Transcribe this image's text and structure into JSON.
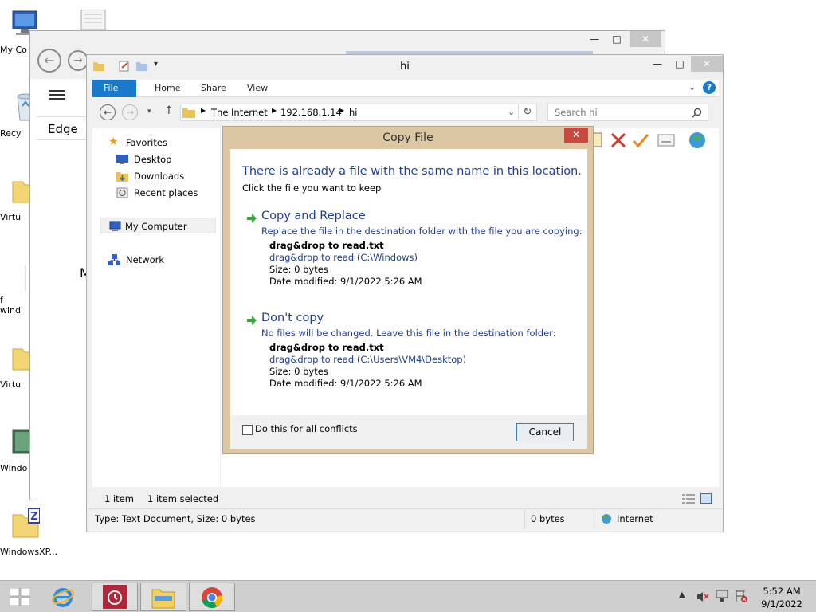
{
  "desktop": {
    "icons": [
      {
        "label": "My Co",
        "icon": "computer-icon"
      },
      {
        "label": "Recy",
        "icon": "recycle-bin-icon"
      },
      {
        "label": "Virtu",
        "icon": "folder-icon"
      },
      {
        "label": "f\nwind",
        "icon": "file-icon"
      },
      {
        "label": "Virtu",
        "icon": "folder-icon"
      },
      {
        "label": "Windo",
        "icon": "image-icon"
      },
      {
        "label": "WindowsXP...",
        "icon": "zip-folder-icon"
      }
    ]
  },
  "edge_window": {
    "sidebar_label": "Edge",
    "partial_text": "M"
  },
  "explorer": {
    "title": "hi",
    "tabs": [
      "File",
      "Home",
      "Share",
      "View"
    ],
    "breadcrumb": [
      "The Internet",
      "192.168.1.14",
      "hi"
    ],
    "search_placeholder": "Search hi",
    "nav": {
      "favorites": "Favorites",
      "desktop": "Desktop",
      "downloads": "Downloads",
      "recent": "Recent places",
      "my_computer": "My Computer",
      "network": "Network"
    },
    "status": {
      "item_count": "1 item",
      "selected": "1 item selected"
    },
    "details": {
      "type": "Type: Text Document, Size: 0 bytes",
      "size": "0 bytes",
      "zone": "Internet"
    }
  },
  "dialog": {
    "title": "Copy File",
    "close_label": "✕",
    "heading": "There is already a file with the same name in this location.",
    "subheading": "Click the file you want to keep",
    "replace": {
      "title": "Copy and Replace",
      "description": "Replace the file in the destination folder with the file you are copying:",
      "file_name": "drag&drop to read.txt",
      "file_path": "drag&drop to read (C:\\Windows)",
      "size": "Size: 0 bytes",
      "date": "Date modified: 9/1/2022 5:26 AM"
    },
    "dont_copy": {
      "title": "Don't copy",
      "description": "No files will be changed. Leave this file in the destination folder:",
      "file_name": "drag&drop to read.txt",
      "file_path": "drag&drop to read (C:\\Users\\VM4\\Desktop)",
      "size": "Size: 0 bytes",
      "date": "Date modified: 9/1/2022 5:26 AM"
    },
    "checkbox_label": "Do this for all conflicts",
    "cancel_label": "Cancel"
  },
  "taskbar": {
    "time": "5:52 AM",
    "date": "9/1/2022"
  },
  "colors": {
    "ribbon_active": "#1979ca",
    "dialog_frame": "#dcc7a5",
    "dialog_close": "#c74a40",
    "link_blue": "#1e3d8f",
    "arrow_green": "#3aa53a"
  }
}
